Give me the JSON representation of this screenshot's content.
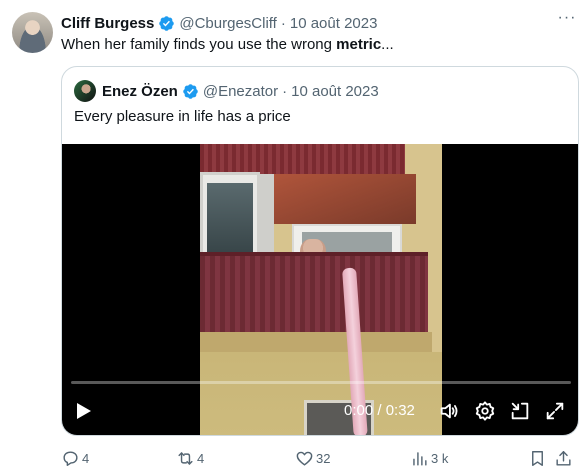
{
  "tweet": {
    "author_name": "Cliff Burgess",
    "handle": "@CburgesCliff",
    "separator": "·",
    "date": "10 août 2023",
    "more_label": "···",
    "text_prefix": "When her family finds you use the wrong ",
    "text_bold": "metric",
    "text_suffix": "..."
  },
  "quoted": {
    "author_name": "Enez Özen",
    "handle": "@Enezator",
    "separator": "·",
    "date": "10 août 2023",
    "text": "Every pleasure in life has a price"
  },
  "video": {
    "time_display": "0:00 / 0:32",
    "progress_fraction": 0.0,
    "controls": [
      "play-icon",
      "volume-icon",
      "settings-icon",
      "minimize-icon",
      "fullscreen-icon"
    ]
  },
  "actions": {
    "replies": "4",
    "reposts": "4",
    "likes": "32",
    "views": "3 k"
  },
  "colors": {
    "verified": "#1d9bf0",
    "text_primary": "#0f1419",
    "text_secondary": "#536471",
    "border": "#cfd9de"
  }
}
